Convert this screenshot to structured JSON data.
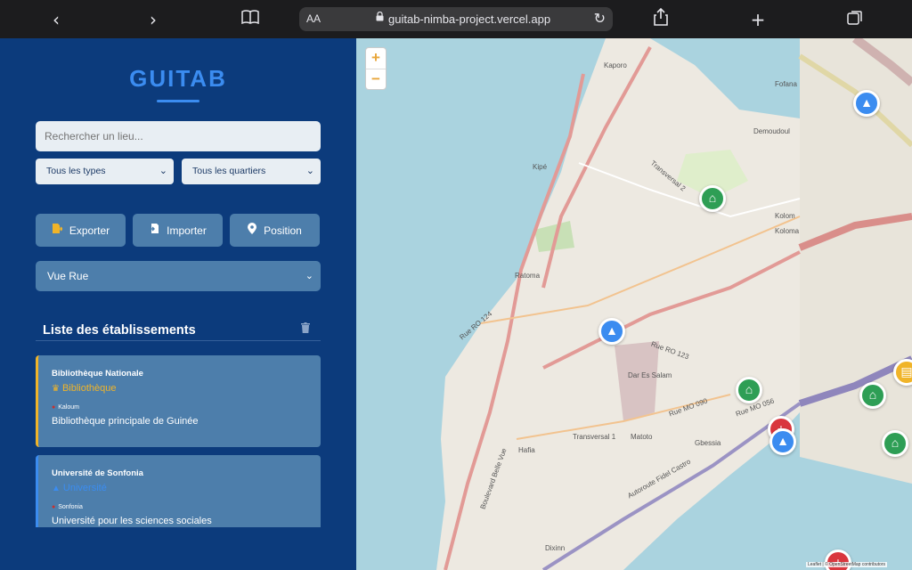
{
  "browser": {
    "back_icon": "chevron-left-icon",
    "forward_icon": "chevron-right-icon",
    "reader_icon": "book-icon",
    "aa_label": "AA",
    "url": "guitab-nimba-project.vercel.app",
    "share_icon": "share-icon",
    "plus_icon": "plus-icon",
    "tabs_icon": "tabs-icon"
  },
  "sidebar": {
    "logo": "GUITAB",
    "search_placeholder": "Rechercher un lieu...",
    "filter_type": "Tous les types",
    "filter_district": "Tous les quartiers",
    "buttons": [
      {
        "label": "Exporter",
        "icon": "export-file-icon"
      },
      {
        "label": "Importer",
        "icon": "import-file-icon"
      },
      {
        "label": "Position",
        "icon": "location-pin-icon"
      }
    ],
    "view_mode": "Vue Rue",
    "list_title": "Liste des établissements",
    "items": [
      {
        "name": "Bibliothèque Nationale",
        "type": "Bibliothèque",
        "type_color": "#f0b429",
        "location": "Kaloum",
        "description": "Bibliothèque principale de Guinée"
      },
      {
        "name": "Université de Sonfonia",
        "type": "Université",
        "type_color": "#3b8cf0",
        "location": "Sonfonia",
        "description": "Université pour les sciences sociales"
      }
    ]
  },
  "map": {
    "zoom_in": "+",
    "zoom_out": "−",
    "labels": [
      "Kaporo",
      "Kipé",
      "Ratoma",
      "Dar Es Salam",
      "Hafia",
      "Gbessia",
      "Matoto",
      "Transversal 1",
      "Transversal 2",
      "Rue RO 124",
      "Rue RO 123",
      "Rue MO 090",
      "Rue MO 056",
      "Autoroute Fidel Castro",
      "Boulevard Belle Vue",
      "Dixinn",
      "Kolom",
      "Kolomа",
      "Demoudoul",
      "Fofana"
    ],
    "attribution": "Leaflet | © OpenStreetMap contributors",
    "markers": [
      {
        "kind": "school",
        "color": "#2e9e55"
      },
      {
        "kind": "university",
        "color": "#3b8cf0"
      },
      {
        "kind": "school",
        "color": "#2e9e55"
      },
      {
        "kind": "hospital",
        "color": "#d9363e"
      },
      {
        "kind": "university",
        "color": "#3b8cf0"
      },
      {
        "kind": "university",
        "color": "#3b8cf0"
      },
      {
        "kind": "school",
        "color": "#2e9e55"
      },
      {
        "kind": "school",
        "color": "#2e9e55"
      },
      {
        "kind": "library",
        "color": "#f0b429"
      },
      {
        "kind": "hospital",
        "color": "#d9363e"
      }
    ]
  }
}
